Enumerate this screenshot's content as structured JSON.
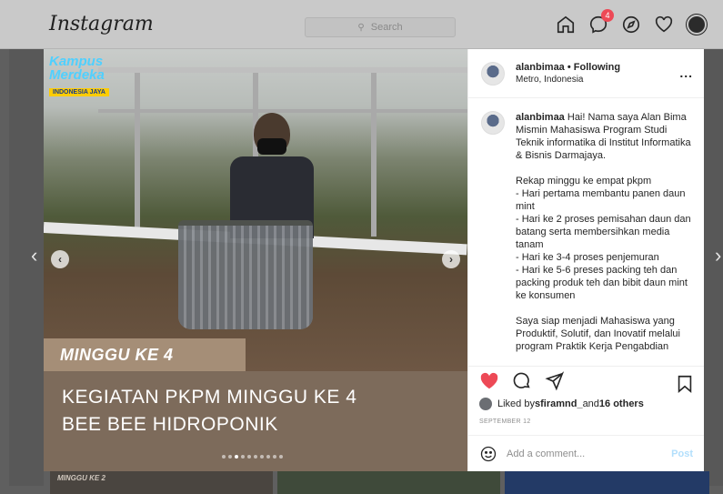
{
  "app": {
    "logo": "Instagram"
  },
  "search": {
    "placeholder": "Search",
    "icon": "search-icon"
  },
  "nav": {
    "icons": [
      "home-icon",
      "direct-message-icon",
      "explore-icon",
      "heart-icon",
      "profile-avatar"
    ],
    "direct_badge": "4"
  },
  "post": {
    "overlay": {
      "watermark_line1": "Kampus",
      "watermark_line2": "Merdeka",
      "watermark_tag": "INDONESIA JAYA",
      "week_tag": "MINGGU KE 4",
      "headline_line1": "KEGIATAN PKPM MINGGU KE 4",
      "headline_line2": "BEE BEE HIDROPONIK"
    },
    "carousel": {
      "count": 10,
      "active_index": 2
    },
    "author": {
      "username": "alanbimaa",
      "follow_status": "• Following",
      "location": "Metro, Indonesia"
    },
    "caption": {
      "username": "alanbimaa",
      "text": " Hai! Nama saya Alan Bima Mismin Mahasiswa Program Studi Teknik informatika di Institut Informatika & Bisnis Darmajaya.\n\nRekap minggu ke empat pkpm\n- Hari pertama membantu panen daun mint\n- Hari ke 2 proses pemisahan daun dan batang serta membersihkan media tanam\n- Hari ke 3-4 proses penjemuran\n- Hari ke 5-6 preses packing teh dan packing produk teh dan bibit daun mint ke konsumen\n\nSaya siap menjadi Mahasiswa yang Produktif, Solutif, dan Inovatif melalui program Praktik Kerja Pengabdian"
    },
    "likes": {
      "prefix": "Liked by ",
      "user": "sfiramnd_",
      "middle": " and ",
      "others": "16 others"
    },
    "date": "SEPTEMBER 12",
    "comment": {
      "placeholder": "Add a comment...",
      "post_label": "Post"
    },
    "more_label": "..."
  },
  "colors": {
    "like_red": "#ed4956",
    "post_blue_disabled": "#b2dffc",
    "banner_brown": "#7d6b5b",
    "tag_tan": "#a58e77"
  },
  "background": {
    "thumb_label": "MINGGU KE 2"
  }
}
